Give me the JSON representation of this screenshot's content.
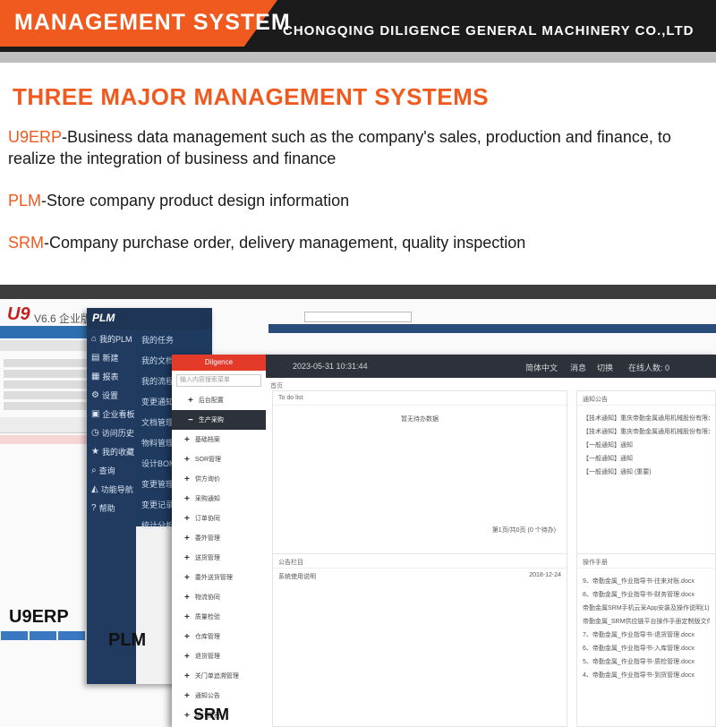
{
  "header": {
    "title": "MANAGEMENT SYSTEM",
    "company": "CHONGQING DILIGENCE GENERAL MACHINERY CO.,LTD"
  },
  "intro": {
    "section_title": "THREE MAJOR MANAGEMENT SYSTEMS",
    "systems": [
      {
        "name": "U9ERP",
        "desc": "-Business data management such as the company's sales, production and finance, to realize the integration of business and finance"
      },
      {
        "name": "PLM",
        "desc": "-Store company product design information"
      },
      {
        "name": "SRM",
        "desc": "-Company purchase order, delivery management, quality inspection"
      }
    ]
  },
  "colors": {
    "accent": "#f05a1e",
    "dark_band": "#1b1b1b",
    "srm_brand": "#e43a2a"
  },
  "u9": {
    "logo": "U9",
    "version": "V6.6 企业版",
    "label": "U9ERP"
  },
  "plm": {
    "logo": "PLM",
    "label": "PLM",
    "side_items": [
      {
        "label": "我的PLM",
        "icon": "home-icon"
      },
      {
        "label": "新建",
        "icon": "file-icon"
      },
      {
        "label": "报表",
        "icon": "chart-icon"
      },
      {
        "label": "设置",
        "icon": "gear-icon"
      },
      {
        "label": "企业看板",
        "icon": "board-icon"
      },
      {
        "label": "访问历史",
        "icon": "history-icon"
      },
      {
        "label": "我的收藏",
        "icon": "star-icon"
      },
      {
        "label": "查询",
        "icon": "search-icon"
      },
      {
        "label": "功能导航",
        "icon": "nav-icon"
      },
      {
        "label": "帮助",
        "icon": "help-icon"
      }
    ],
    "sub_items": [
      "我的任务",
      "我的文档",
      "我的流程",
      "变更通知",
      "文档管理",
      "物料管理",
      "设计BOM",
      "变更管理",
      "变更记录",
      "统计分析"
    ]
  },
  "srm": {
    "label": "SRM",
    "logo": "Dilgence",
    "datetime": "2023-05-31 10:31:44",
    "search_placeholder": "输入内容搜索菜单",
    "topbar": {
      "lang": "简体中文",
      "msg": "消息",
      "switch": "切换",
      "online": "在线人数: 0"
    },
    "breadcrumb": "首页",
    "menu": [
      {
        "label": "后台配置",
        "active": false,
        "sub": false
      },
      {
        "label": "生产采购",
        "active": true,
        "sub": false
      },
      {
        "label": "基础档案",
        "active": false,
        "sub": true
      },
      {
        "label": "SOR管理",
        "active": false,
        "sub": true
      },
      {
        "label": "供方询价",
        "active": false,
        "sub": true
      },
      {
        "label": "采购通知",
        "active": false,
        "sub": true
      },
      {
        "label": "订单协同",
        "active": false,
        "sub": true
      },
      {
        "label": "委外管理",
        "active": false,
        "sub": true
      },
      {
        "label": "送货管理",
        "active": false,
        "sub": true
      },
      {
        "label": "委外送货管理",
        "active": false,
        "sub": true
      },
      {
        "label": "物流协同",
        "active": false,
        "sub": true
      },
      {
        "label": "质量检验",
        "active": false,
        "sub": true
      },
      {
        "label": "仓库管理",
        "active": false,
        "sub": true
      },
      {
        "label": "退货管理",
        "active": false,
        "sub": true
      },
      {
        "label": "关门单追溯管理",
        "active": false,
        "sub": true
      },
      {
        "label": "通知公告",
        "active": false,
        "sub": true
      },
      {
        "label": "统计报表",
        "active": false,
        "sub": true
      }
    ],
    "todo": {
      "title": "To do list",
      "empty": "暂无待办数据",
      "pager": "第1页/共0页 (0 个待办)"
    },
    "notice": {
      "title": "通知公告",
      "items": [
        "【技术通知】重庆帝勤金属通用机械股份有限公司",
        "【技术通知】重庆帝勤金属通用机械股份有限公司",
        "【一般通知】通知",
        "【一般通知】通知",
        "【一般通知】通知 (重要)"
      ]
    },
    "bulletin": {
      "title": "公告栏目",
      "item": "系统使用说明",
      "date": "2018-12-24"
    },
    "manual": {
      "title": "操作手册",
      "items": [
        "9、帝勤金属_作业指导书-往来对账.docx",
        "8、帝勤金属_作业指导书-财务管理.docx",
        "帝勤金属SRM手机云采App安装及操作说明(1).docx",
        "帝勤金属_SRM供应链平台操作手册定制版文件.docx",
        "7、帝勤金属_作业指导书-退货管理.docx",
        "6、帝勤金属_作业指导书-入库管理.docx",
        "5、帝勤金属_作业指导书-质检管理.docx",
        "4、帝勤金属_作业指导书-到货管理.docx"
      ]
    }
  }
}
